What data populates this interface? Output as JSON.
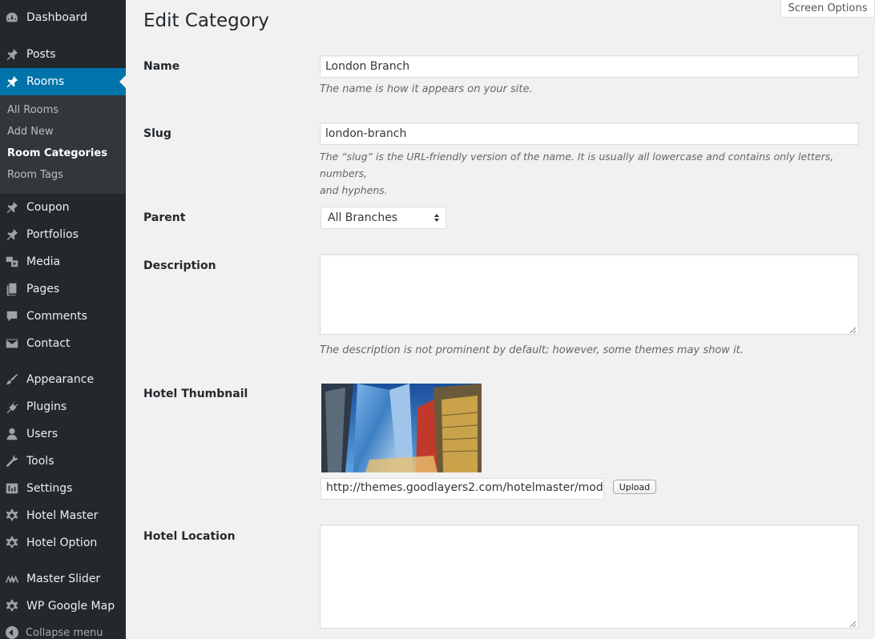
{
  "sidebar": {
    "items": [
      {
        "label": "Dashboard",
        "icon": "dashboard-icon"
      },
      {
        "label": "Posts",
        "icon": "pin-icon"
      },
      {
        "label": "Rooms",
        "icon": "pin-icon"
      },
      {
        "label": "Coupon",
        "icon": "pin-icon"
      },
      {
        "label": "Portfolios",
        "icon": "pin-icon"
      },
      {
        "label": "Media",
        "icon": "media-icon"
      },
      {
        "label": "Pages",
        "icon": "pages-icon"
      },
      {
        "label": "Comments",
        "icon": "comments-icon"
      },
      {
        "label": "Contact",
        "icon": "mail-icon"
      },
      {
        "label": "Appearance",
        "icon": "brush-icon"
      },
      {
        "label": "Plugins",
        "icon": "plugin-icon"
      },
      {
        "label": "Users",
        "icon": "users-icon"
      },
      {
        "label": "Tools",
        "icon": "wrench-icon"
      },
      {
        "label": "Settings",
        "icon": "settings-icon"
      },
      {
        "label": "Hotel Master",
        "icon": "gear-icon"
      },
      {
        "label": "Hotel Option",
        "icon": "gear-icon"
      },
      {
        "label": "Master Slider",
        "icon": "slider-icon"
      },
      {
        "label": "WP Google Map",
        "icon": "gear-icon"
      }
    ],
    "submenu": [
      "All Rooms",
      "Add New",
      "Room Categories",
      "Room Tags"
    ],
    "collapse_label": "Collapse menu",
    "active_color": "#0073aa"
  },
  "screen_options": "Screen Options",
  "page_title": "Edit Category",
  "form": {
    "name": {
      "label": "Name",
      "value": "London Branch",
      "description": "The name is how it appears on your site."
    },
    "slug": {
      "label": "Slug",
      "value": "london-branch",
      "description_line1": "The “slug” is the URL-friendly version of the name. It is usually all lowercase and contains only letters, numbers,",
      "description_line2": "and hyphens."
    },
    "parent": {
      "label": "Parent",
      "value": "All Branches"
    },
    "description": {
      "label": "Description",
      "value": "",
      "help": "The description is not prominent by default; however, some themes may show it."
    },
    "thumbnail": {
      "label": "Hotel Thumbnail",
      "url": "http://themes.goodlayers2.com/hotelmaster/modern",
      "upload_label": "Upload"
    },
    "location": {
      "label": "Hotel Location",
      "value": ""
    }
  }
}
